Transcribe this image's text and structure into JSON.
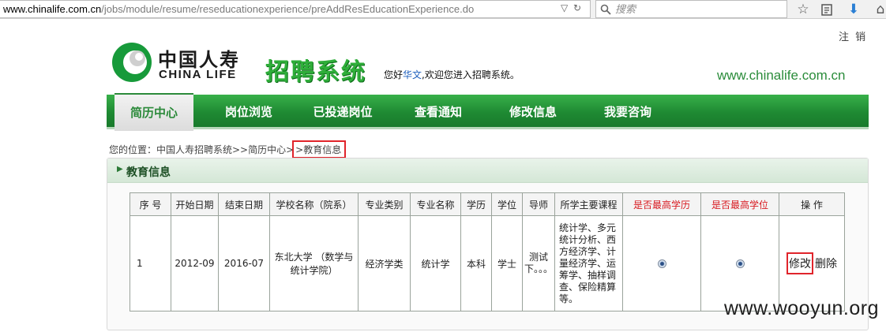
{
  "browser": {
    "url_host": "www.chinalife.com.cn",
    "url_path": "/jobs/module/resume/reseducationexperience/preAddResEducationExperience.do",
    "search_placeholder": "搜索"
  },
  "header": {
    "logout": "注 销",
    "logo_cn": "中国人寿",
    "logo_en": "CHINA LIFE",
    "brand_title": "招聘系统",
    "welcome_prefix": "您好",
    "username": "华文",
    "welcome_suffix": ",欢迎您进入招聘系统。",
    "site_url": "www.chinalife.com.cn"
  },
  "nav": {
    "items": [
      "简历中心",
      "岗位浏览",
      "已投递岗位",
      "查看通知",
      "修改信息",
      "我要咨询"
    ],
    "active_index": 0
  },
  "breadcrumb": {
    "prefix": "您的位置：中国人寿招聘系统>>简历中心>",
    "current": ">教育信息"
  },
  "panel": {
    "title": "教育信息"
  },
  "table": {
    "headers": [
      "序 号",
      "开始日期",
      "结束日期",
      "学校名称（院系）",
      "专业类别",
      "专业名称",
      "学历",
      "学位",
      "导师",
      "所学主要课程",
      "是否最高学历",
      "是否最高学位",
      "操 作"
    ],
    "rows": [
      {
        "index": "1",
        "start": "2012-09",
        "end": "2016-07",
        "school": "东北大学 （数学与统计学院）",
        "category": "经济学类",
        "major": "统计学",
        "education": "本科",
        "degree": "学士",
        "tutor": "测试下。。。",
        "courses": "统计学、多元统计分析、西方经济学、计量经济学、运筹学、抽样调查、保险精算等。",
        "edit": "修改",
        "delete": "删除"
      }
    ]
  },
  "colors": {
    "nav_green": "#1f8a33",
    "brand_green": "#2fae3a",
    "highlight_red": "#e0242b",
    "header_red": "#d8191f"
  },
  "watermark": "www.wooyun.org"
}
